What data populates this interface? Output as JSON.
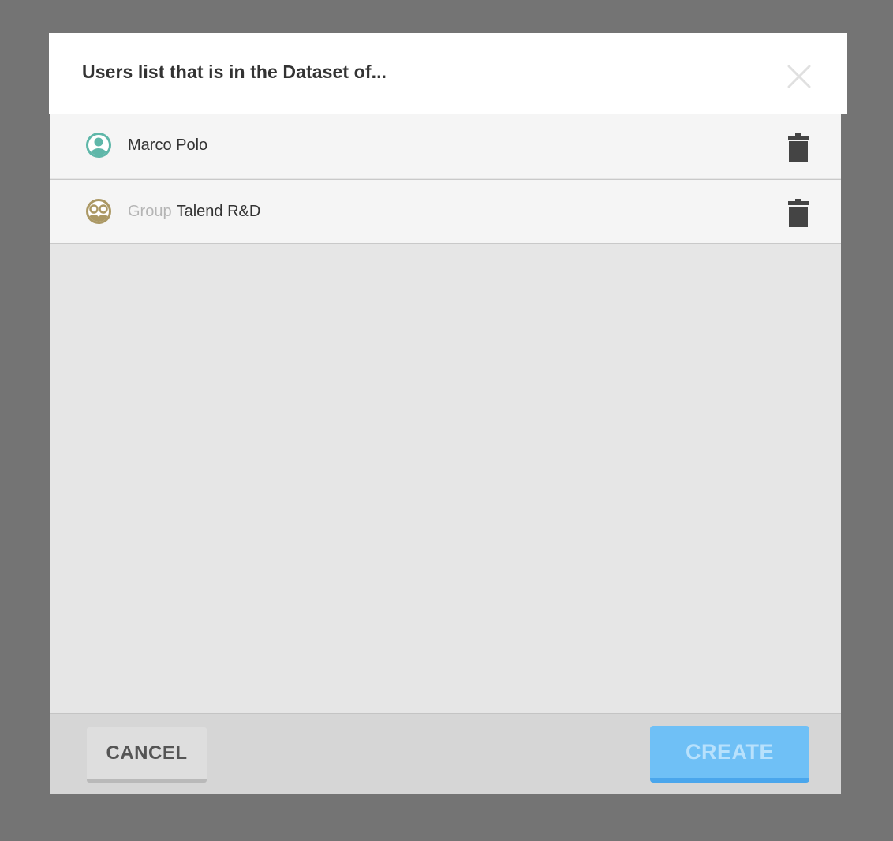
{
  "dialog": {
    "title": "Users list that is in the Dataset of...",
    "close_icon": "close-icon"
  },
  "list": {
    "items": [
      {
        "type": "user",
        "icon": "user-icon",
        "icon_color": "#5fb7a9",
        "prefix": "",
        "name": "Marco Polo",
        "delete_icon": "trash-icon"
      },
      {
        "type": "group",
        "icon": "group-icon",
        "icon_color": "#ab9864",
        "prefix": "Group",
        "name": "Talend R&D",
        "delete_icon": "trash-icon"
      }
    ]
  },
  "footer": {
    "cancel_label": "CANCEL",
    "create_label": "CREATE"
  },
  "colors": {
    "overlay": "#747474",
    "create_button": "#6fc0f6",
    "cancel_button": "#dedede"
  }
}
